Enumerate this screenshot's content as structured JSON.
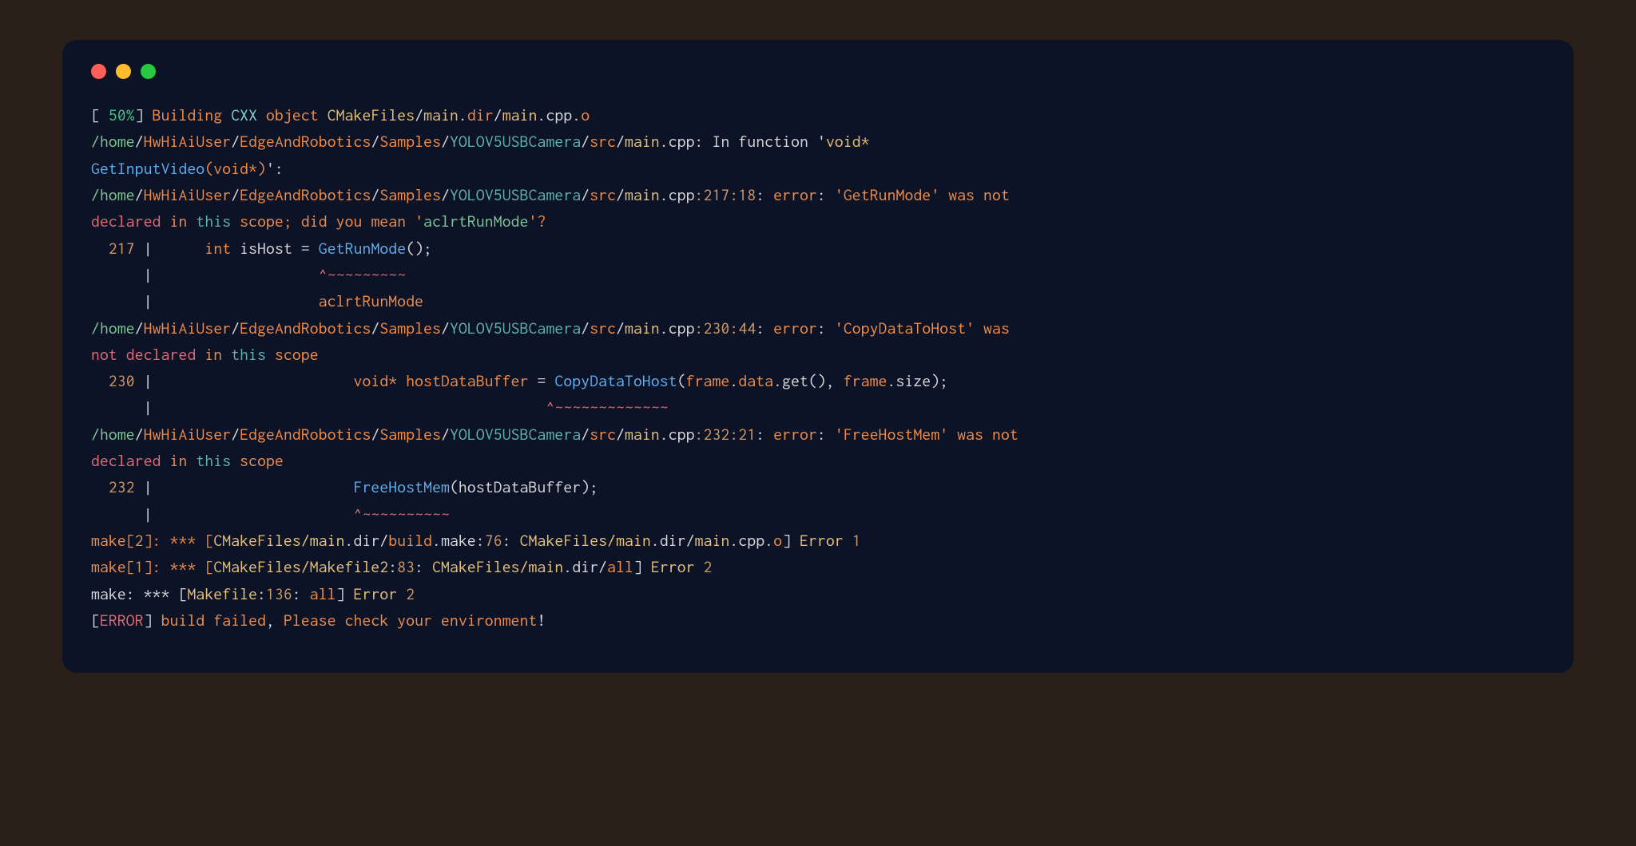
{
  "titlebar": {
    "dot_close": "close-window",
    "dot_min": "minimize-window",
    "dot_max": "maximize-window"
  },
  "lines": {
    "l1_bracket_open": "[ ",
    "l1_percent": "50%",
    "l1_bracket_close": "] ",
    "l1_building": "Building ",
    "l1_cxx": "CXX",
    "l1_object": " object ",
    "l1_cmakefiles": "CMakeFiles",
    "l1_slash1": "/",
    "l1_main1": "main",
    "l1_dot_dir": ".",
    "l1_dir": "dir",
    "l1_slash2": "/",
    "l1_main2": "main",
    "l1_dot_cpp": ".cpp.",
    "l1_o": "o",
    "path_home": "/home",
    "path_slash": "/",
    "path_user": "HwHiAiUser",
    "path_edge": "EdgeAndRobotics",
    "path_samples": "Samples",
    "path_yolo": "YOLOV5USBCamera",
    "path_src": "src",
    "path_main": "main",
    "path_dot_cpp": ".cpp",
    "in_function": ": In function '",
    "void_star": "void* ",
    "getinputvideo": "GetInputVideo",
    "void_arg": "(void*)",
    "in_function_end": "':",
    "loc_217_18": ":217:18",
    "colon_space": ": ",
    "error_label": "error",
    "err1_msg_a": "'GetRunMode' was not ",
    "err1_msg_b": "declared ",
    "err1_msg_c": "in ",
    "err1_this": "this",
    "err1_scope": " scope",
    "err1_did": "; did you mean '",
    "aclrt": "aclrtRunMode",
    "err1_did_end": "'?",
    "line217_num": "  217",
    "pipe": " | ",
    "indent6": "     ",
    "int_kw": "int ",
    "isHost": "isHost",
    "eq": " = ",
    "getRunMode": "GetRunMode",
    "parens": "();",
    "gutter_blank": "      | ",
    "carets1": "                  ^~~~~~~~~~",
    "aclrt_line": "                  aclrtRunMode",
    "loc_230_44": ":230:44",
    "err2_msg_a": "'CopyDataToHost' was ",
    "err2_msg_b": "not declared ",
    "err2_msg_c": "in ",
    "err2_scope": " scope",
    "line230_num": "  230",
    "indent24": "                      ",
    "void_star_kw": "void* ",
    "hostDataBuffer": "hostDataBuffer",
    "copyDataToHost": "CopyDataToHost",
    "paren_open": "(",
    "frame": "frame",
    "dot": ".",
    "data_word": "data",
    "get_call": ".get(), ",
    "size_word": ".size",
    "paren_close_semi": ");",
    "carets2": "                                            ^~~~~~~~~~~~~~",
    "loc_232_21": ":232:21",
    "err3_msg_a": "'FreeHostMem' was not ",
    "err3_msg_b": "declared ",
    "err3_msg_c": "in ",
    "err3_scope": " scope",
    "line232_num": "  232",
    "indent22": "                      ",
    "freeHostMem": "FreeHostMem",
    "hdb_arg": "(hostDataBuffer);",
    "carets3": "                      ^~~~~~~~~~~",
    "make2_a": "make[",
    "make2_n": "2",
    "make2_b": "]: *** [",
    "make2_c": "CMakeFiles/main",
    "make2_d": ".dir/",
    "make2_build": "build",
    "make2_e": ".make:",
    "make2_76": "76",
    "make2_f": ": ",
    "make2_g": "CMakeFiles/main",
    "make2_h": ".dir/",
    "make2_main": "main",
    "make2_i": ".cpp.",
    "make2_o": "o",
    "make2_j": "] ",
    "make2_err": "Error ",
    "make2_1": "1",
    "make1_a": "make[",
    "make1_n": "1",
    "make1_b": "]: *** [",
    "make1_c": "CMakeFiles/Makefile2",
    "make1_d": ":",
    "make1_83": "83",
    "make1_e": ": ",
    "make1_f": "CMakeFiles/main",
    "make1_g": ".dir/",
    "make1_all": "all",
    "make1_h": "] ",
    "make1_err": "Error ",
    "make1_2": "2",
    "make0_a": "make: *** [",
    "make0_mk": "Makefile",
    "make0_b": ":",
    "make0_136": "136",
    "make0_c": ": ",
    "make0_all": "all",
    "make0_d": "] ",
    "make0_err": "Error ",
    "make0_2": "2",
    "final_bracket_open": "[",
    "final_error": "ERROR",
    "final_bracket_close": "] ",
    "final_build": "build failed",
    "final_comma": ", ",
    "final_please": "Please check your environment",
    "final_bang": "!"
  }
}
